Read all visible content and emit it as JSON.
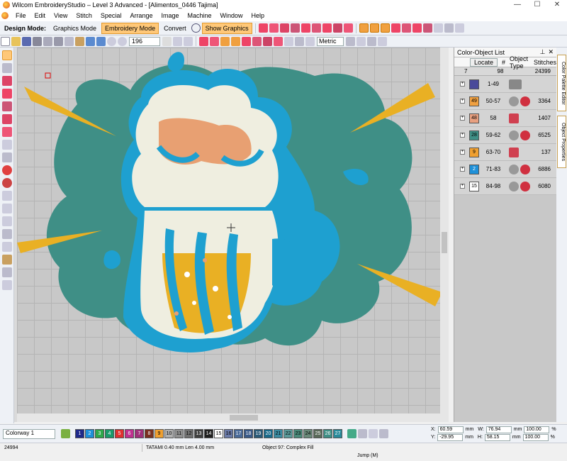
{
  "window": {
    "title": "Wilcom EmbroideryStudio – Level 3 Advanced - [Alimentos_0446      Tajima]"
  },
  "menu": [
    "File",
    "Edit",
    "View",
    "Stitch",
    "Special",
    "Arrange",
    "Image",
    "Machine",
    "Window",
    "Help"
  ],
  "toolbar": {
    "design_mode_label": "Design Mode:",
    "graphics_mode": "Graphics Mode",
    "embroidery_mode": "Embroidery Mode",
    "convert": "Convert",
    "show_graphics": "Show Graphics",
    "zoom_value": "196",
    "units": "Metric"
  },
  "panel": {
    "title": "Color-Object List",
    "locate": "Locate",
    "col_num": "#",
    "col_type": "Object Type",
    "col_stitches": "Stitches",
    "summary": {
      "colors": "7",
      "objects": "98",
      "stitches": "24399"
    },
    "rows": [
      {
        "color_no": "",
        "range": "1-49",
        "stitches": "",
        "color": "#4a4a9a"
      },
      {
        "color_no": "49",
        "range": "50-57",
        "stitches": "3364",
        "color": "#f0a040"
      },
      {
        "color_no": "48",
        "range": "58",
        "stitches": "1407",
        "color": "#e8a080"
      },
      {
        "color_no": "28",
        "range": "59-62",
        "stitches": "6525",
        "color": "#3f8f86"
      },
      {
        "color_no": "9",
        "range": "63-70",
        "stitches": "137",
        "color": "#f0a030"
      },
      {
        "color_no": "2",
        "range": "71-83",
        "stitches": "6886",
        "color": "#1e90d8"
      },
      {
        "color_no": "15",
        "range": "84-98",
        "stitches": "6080",
        "color": "#ffffff"
      }
    ]
  },
  "sidetabs": [
    "Color Palette Editor",
    "Object Properties"
  ],
  "colorbar": {
    "colorway": "Colorway 1",
    "chips": [
      {
        "n": "1",
        "c": "#1f2a8a"
      },
      {
        "n": "2",
        "c": "#1e90d8"
      },
      {
        "n": "3",
        "c": "#2ea84a"
      },
      {
        "n": "4",
        "c": "#1a9a6a"
      },
      {
        "n": "5",
        "c": "#e03030"
      },
      {
        "n": "6",
        "c": "#c03090"
      },
      {
        "n": "7",
        "c": "#a0307a"
      },
      {
        "n": "8",
        "c": "#7a3020"
      },
      {
        "n": "9",
        "c": "#f0a030"
      },
      {
        "n": "10",
        "c": "#b0b0b0"
      },
      {
        "n": "11",
        "c": "#909090"
      },
      {
        "n": "12",
        "c": "#707070"
      },
      {
        "n": "13",
        "c": "#404040"
      },
      {
        "n": "14",
        "c": "#202020"
      },
      {
        "n": "15",
        "c": "#ffffff"
      },
      {
        "n": "16",
        "c": "#6a7aa8"
      },
      {
        "n": "17",
        "c": "#4a6a98"
      },
      {
        "n": "18",
        "c": "#3a5a88"
      },
      {
        "n": "19",
        "c": "#2a5a78"
      },
      {
        "n": "20",
        "c": "#1a6a8a"
      },
      {
        "n": "21",
        "c": "#3a8aa0"
      },
      {
        "n": "22",
        "c": "#5a9a9a"
      },
      {
        "n": "23",
        "c": "#4a8a7a"
      },
      {
        "n": "24",
        "c": "#6a8a7a"
      },
      {
        "n": "25",
        "c": "#5a6a5a"
      },
      {
        "n": "26",
        "c": "#3f8f86"
      },
      {
        "n": "27",
        "c": "#2a8a9a"
      }
    ]
  },
  "coords": {
    "x": "60.59",
    "y": "-29.95",
    "w": "76.94",
    "h": "58.15",
    "unit": "mm",
    "pw": "100.00",
    "ph": "100.00",
    "pct": "%"
  },
  "status": {
    "stitch_count": "24994",
    "fill_info": "TATAMI  0.40 mm Len  4.00 mm",
    "object_info": "Object 97: Complex Fill",
    "jump": "Jump (M)"
  }
}
